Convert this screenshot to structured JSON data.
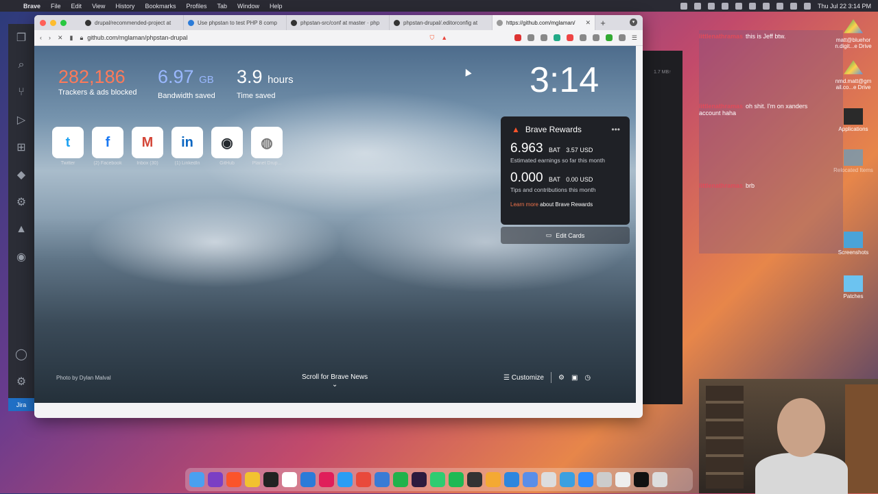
{
  "menubar": {
    "app": "Brave",
    "items": [
      "File",
      "Edit",
      "View",
      "History",
      "Bookmarks",
      "Profiles",
      "Tab",
      "Window",
      "Help"
    ],
    "clock": "Thu Jul 22  3:14 PM"
  },
  "browser": {
    "tabs": [
      {
        "label": "drupal/recommended-project at"
      },
      {
        "label": "Use phpstan to test PHP 8 comp"
      },
      {
        "label": "phpstan-src/conf at master · php"
      },
      {
        "label": "phpstan-drupal/.editorconfig at"
      },
      {
        "label": "https://github.com/mglaman/"
      }
    ],
    "url": "github.com/mglaman/phpstan-drupal"
  },
  "ntp": {
    "stats": [
      {
        "value": "282,186",
        "unit": "",
        "label": "Trackers & ads blocked",
        "color": "#ff7a59"
      },
      {
        "value": "6.97",
        "unit": "GB",
        "label": "Bandwidth saved",
        "color": "#9ab8ff"
      },
      {
        "value": "3.9",
        "unit": "hours",
        "label": "Time saved",
        "color": "#ffffff"
      }
    ],
    "clock": "3:14",
    "tiles": [
      {
        "name": "twitter",
        "glyph": "t",
        "label": "Twitter",
        "color": "#1da1f2"
      },
      {
        "name": "facebook",
        "glyph": "f",
        "label": "(2) Facebook",
        "color": "#1877f2"
      },
      {
        "name": "gmail",
        "glyph": "M",
        "label": "Inbox (30)",
        "color": "#d44638"
      },
      {
        "name": "linkedin",
        "glyph": "in",
        "label": "(1) LinkedIn",
        "color": "#0a66c2"
      },
      {
        "name": "github",
        "glyph": "◉",
        "label": "GitHub",
        "color": "#24292e"
      },
      {
        "name": "planet",
        "glyph": "◍",
        "label": "Planet Drup...",
        "color": "#888888"
      }
    ],
    "rewards": {
      "title": "Brave Rewards",
      "earn_value": "6.963",
      "earn_unit": "BAT",
      "earn_usd": "3.57 USD",
      "earn_caption": "Estimated earnings so far this month",
      "tips_value": "0.000",
      "tips_unit": "BAT",
      "tips_usd": "0.00 USD",
      "tips_caption": "Tips and contributions this month",
      "learn_link": "Learn more",
      "learn_rest": " about Brave Rewards"
    },
    "edit_cards": "Edit Cards",
    "photo_credit": "Photo by Dylan Malval",
    "scroll_news": "Scroll for Brave News",
    "customize": "Customize"
  },
  "darkwin": {
    "rate": "1.7 MB↑"
  },
  "chat": [
    {
      "user": "littlenathramas",
      "msg": "this is Jeff btw."
    },
    {
      "user": "littlenathramas",
      "msg": "oh shit. I'm on xanders account haha"
    },
    {
      "user": "littlenathramas",
      "msg": "brb"
    }
  ],
  "desktop": [
    {
      "label": "matt@bluehor n.digit...e Drive"
    },
    {
      "label": "nmd.matt@gm ail.co...e Drive"
    },
    {
      "label": "Applications"
    },
    {
      "label": "Relocated Items"
    },
    {
      "label": "Screenshots"
    },
    {
      "label": "Patches"
    }
  ],
  "vscode": {
    "jira": "Jira"
  },
  "colors": {
    "brave_orange": "#fb542b",
    "accent_link": "#f0734b"
  }
}
